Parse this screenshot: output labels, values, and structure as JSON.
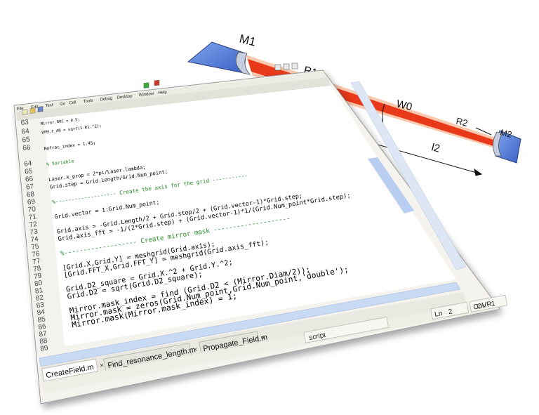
{
  "diagram": {
    "mirror1_label": "M1",
    "mirror2_label": "M2",
    "r1_label": "R1",
    "r2_label": "R2",
    "waist_label": "W0",
    "length_label": "l2",
    "colors": {
      "mirror": "#4a78d8",
      "beam": "#e8391a",
      "beam_glow": "#f7a16e"
    }
  },
  "editor": {
    "menu": [
      "File",
      "Edit",
      "Text",
      "Go",
      "Cell",
      "Tools",
      "Debug",
      "Desktop",
      "Window",
      "Help"
    ],
    "zoom_value": "1.0",
    "zoom_value2": "1.1",
    "search_label": "Stack:",
    "code_lines": [
      {
        "num": "63",
        "text": "Mirror.ROC = 0.5;",
        "color": "#000000"
      },
      {
        "num": "64",
        "text": "RFM.t_AR = sqrt(1-R1.^2);",
        "color": "#000000"
      },
      {
        "num": "65",
        "text": "",
        "color": "#000000"
      },
      {
        "num": "66",
        "text": "Refrac_index = 1.45;",
        "color": "#000000"
      },
      {
        "num": "",
        "text": "",
        "color": "#000000"
      },
      {
        "num": "64",
        "text": "% Variable",
        "color": "#228b22"
      },
      {
        "num": "65",
        "text": "",
        "color": "#000000"
      },
      {
        "num": "66",
        "text": "Laser.k_prop = 2*pi/Laser.lambda;",
        "color": "#000000"
      },
      {
        "num": "67",
        "text": "Grid.step = Grid.Length/Grid.Num_point;",
        "color": "#000000"
      },
      {
        "num": "68",
        "text": "",
        "color": "#000000"
      },
      {
        "num": "69",
        "text": "%------------------- Create the axis for the grid -----------",
        "color": "#228b22"
      },
      {
        "num": "70",
        "text": "",
        "color": "#000000"
      },
      {
        "num": "71",
        "text": "Grid.vector = 1:Grid.Num_point;",
        "color": "#000000"
      },
      {
        "num": "72",
        "text": "",
        "color": "#000000"
      },
      {
        "num": "73",
        "text": "Grid.axis = -Grid.Length/2 + Grid.step/2 + (Grid.vector-1)*Grid.step;",
        "color": "#000000"
      },
      {
        "num": "74",
        "text": "Grid.axis_fft = -1/(2*Grid.step) + (Grid.vector-1)*1/(Grid.Num_point*Grid.step);",
        "color": "#000000"
      },
      {
        "num": "75",
        "text": "",
        "color": "#000000"
      },
      {
        "num": "76",
        "text": "%------------------- Create mirror mask --------------------",
        "color": "#228b22"
      },
      {
        "num": "77",
        "text": "",
        "color": "#000000"
      },
      {
        "num": "78",
        "text": "[Grid.X,Grid.Y] = meshgrid(Grid.axis);",
        "color": "#000000"
      },
      {
        "num": "79",
        "text": "[Grid.FFT_X,Grid.FFT_Y] = meshgrid(Grid.axis_fft);",
        "color": "#000000"
      },
      {
        "num": "80",
        "text": "",
        "color": "#000000"
      },
      {
        "num": "81",
        "text": "Grid.D2_square = Grid.X.^2 + Grid.Y.^2;",
        "color": "#000000"
      },
      {
        "num": "82",
        "text": "Grid.D2 = sqrt(Grid.D2_square);",
        "color": "#000000"
      },
      {
        "num": "83",
        "text": "",
        "color": "#000000"
      },
      {
        "num": "84",
        "text": "Mirror.mask_index = find (Grid.D2 < (Mirror.Diam/2));",
        "color": "#000000"
      },
      {
        "num": "85",
        "text": "Mirror.mask = zeros(Grid.Num_point,Grid.Num_point,'double');",
        "color": "#000000"
      },
      {
        "num": "86",
        "text": "Mirror.mask(Mirror.mask_index) = 1;",
        "color": "#000000"
      },
      {
        "num": "87",
        "text": "",
        "color": "#000000"
      },
      {
        "num": "88",
        "text": "",
        "color": "#000000"
      },
      {
        "num": "89",
        "text": "",
        "color": "#000000"
      }
    ],
    "tabs": [
      {
        "label": "CreateField.m",
        "active": true
      },
      {
        "label": "Find_resonance_length.m",
        "active": false
      },
      {
        "label": "Propagate_Field.m",
        "active": false
      }
    ],
    "status": {
      "mode": "script",
      "ln_label": "Ln",
      "ln_value": "2",
      "col_label": "Col",
      "col_value": "1",
      "ovr": "OVR"
    }
  }
}
